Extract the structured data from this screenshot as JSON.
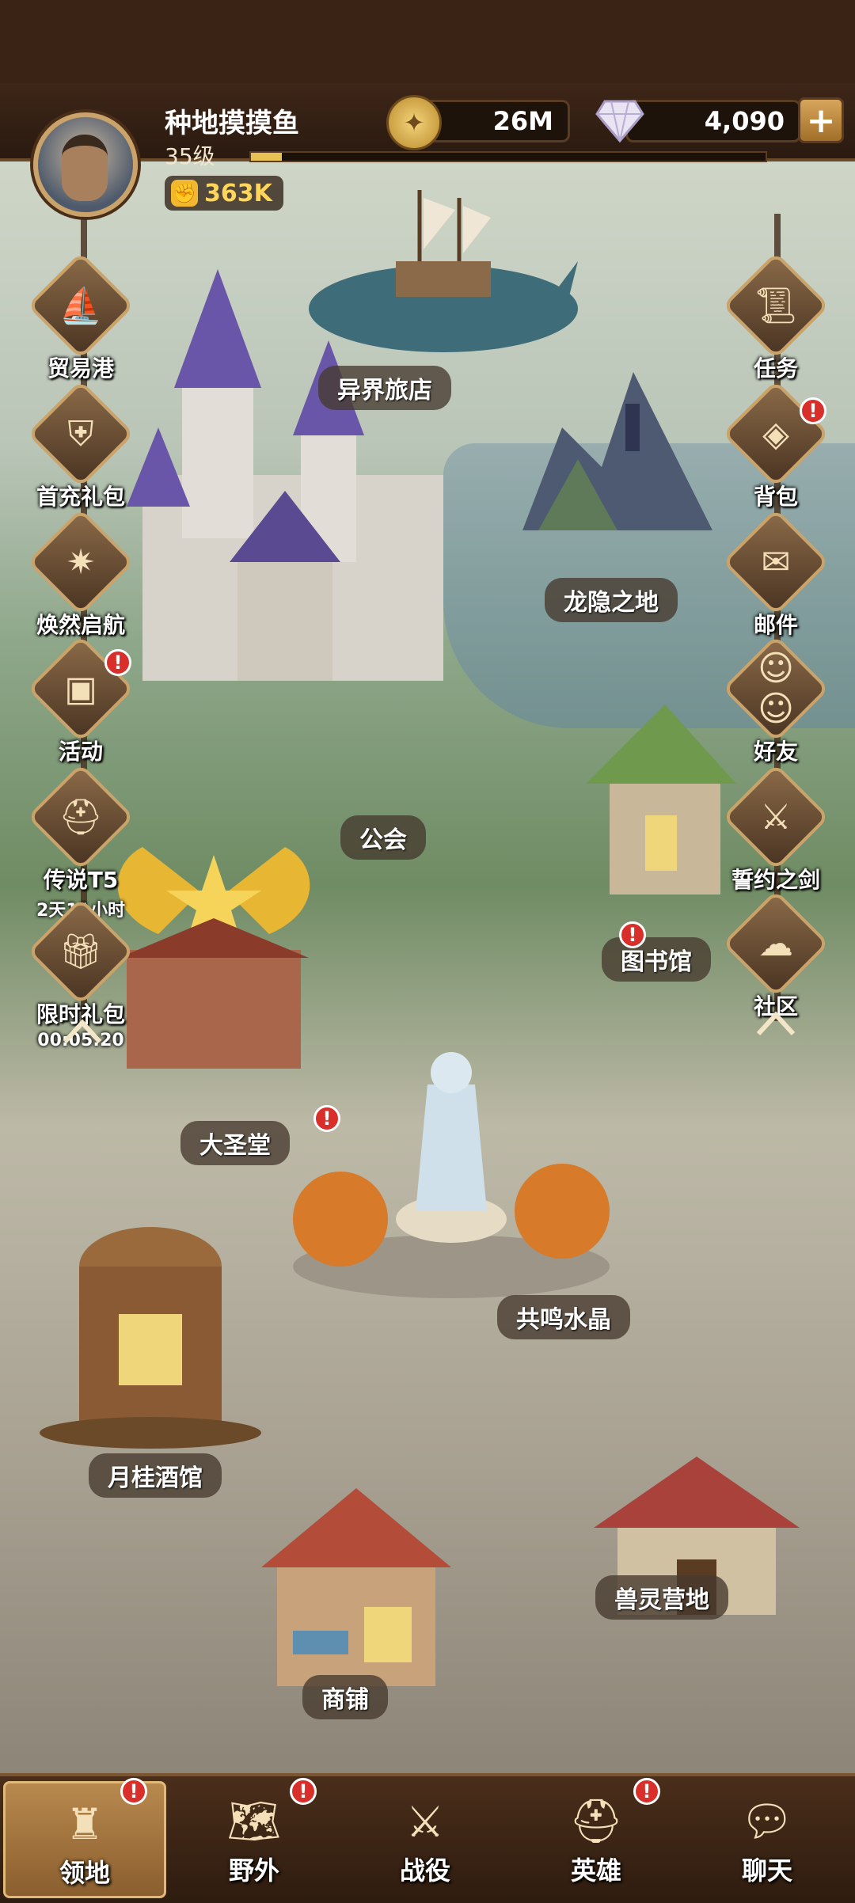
{
  "player": {
    "name": "种地摸摸鱼",
    "level": "35级",
    "xp_fraction": 0.06,
    "power": "363K"
  },
  "resources": {
    "gold": "26M",
    "diamonds": "4,090"
  },
  "left_menu": [
    {
      "label": "贸易港",
      "icon": "ship-icon",
      "badge": false,
      "sub": ""
    },
    {
      "label": "首充礼包",
      "icon": "shield-icon",
      "badge": false,
      "sub": ""
    },
    {
      "label": "焕然启航",
      "icon": "star-banner-icon",
      "badge": false,
      "sub": ""
    },
    {
      "label": "活动",
      "icon": "chest-icon",
      "badge": true,
      "sub": ""
    },
    {
      "label": "传说T5",
      "icon": "helmet-icon",
      "badge": false,
      "sub": "2天11小时"
    },
    {
      "label": "限时礼包",
      "icon": "gift-icon",
      "badge": false,
      "sub": "00:05:20"
    }
  ],
  "right_menu": [
    {
      "label": "任务",
      "icon": "scroll-icon",
      "badge": false
    },
    {
      "label": "背包",
      "icon": "bag-icon",
      "badge": true
    },
    {
      "label": "邮件",
      "icon": "mail-icon",
      "badge": false
    },
    {
      "label": "好友",
      "icon": "friends-icon",
      "badge": false
    },
    {
      "label": "誓约之剑",
      "icon": "sword-icon",
      "badge": false
    },
    {
      "label": "社区",
      "icon": "community-icon",
      "badge": false
    }
  ],
  "buildings": {
    "otherworld_inn": "异界旅店",
    "dragon_land": "龙隐之地",
    "guild": "公会",
    "library": "图书馆",
    "cathedral": "大圣堂",
    "resonance_crystal": "共鸣水晶",
    "tavern": "月桂酒馆",
    "beast_camp": "兽灵营地",
    "shop": "商铺"
  },
  "nav": [
    {
      "label": "领地",
      "icon": "castle-icon",
      "badge": true,
      "active": true
    },
    {
      "label": "野外",
      "icon": "map-icon",
      "badge": true,
      "active": false
    },
    {
      "label": "战役",
      "icon": "battle-icon",
      "badge": false,
      "active": false
    },
    {
      "label": "英雄",
      "icon": "hero-helmet-icon",
      "badge": true,
      "active": false
    },
    {
      "label": "聊天",
      "icon": "chat-icon",
      "badge": false,
      "active": false
    }
  ],
  "badge_symbol": "!",
  "colors": {
    "badge_red": "#d92f2a",
    "gold_text": "#ffd65a",
    "frame": "#caa36a"
  }
}
